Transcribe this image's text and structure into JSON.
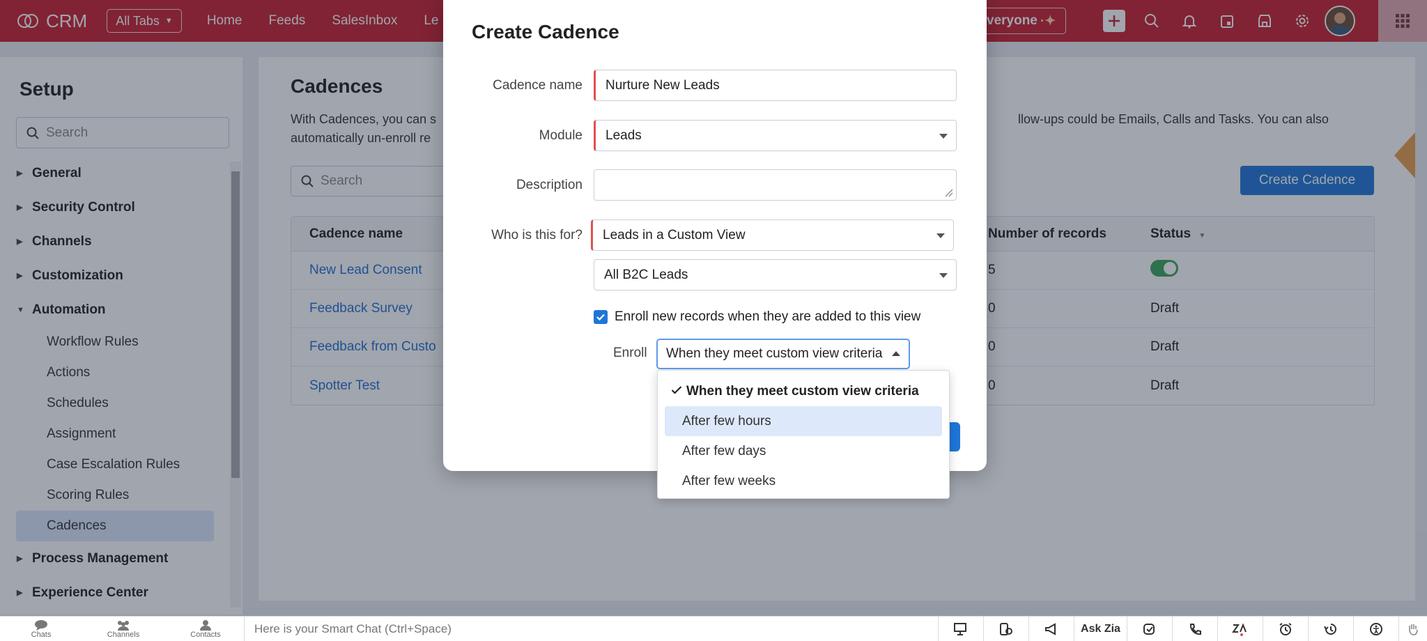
{
  "topbar": {
    "app_name": "CRM",
    "all_tabs_label": "All Tabs",
    "nav": [
      "Home",
      "Feeds",
      "SalesInbox",
      "Le"
    ],
    "everyone_label": "veryone",
    "icons": [
      "plus-icon",
      "search-icon",
      "bell-icon",
      "calendar-icon",
      "store-icon",
      "gear-icon",
      "avatar",
      "grid-icon"
    ]
  },
  "setup": {
    "title": "Setup",
    "search_placeholder": "Search",
    "menu": [
      {
        "label": "General",
        "expanded": false
      },
      {
        "label": "Security Control",
        "expanded": false
      },
      {
        "label": "Channels",
        "expanded": false
      },
      {
        "label": "Customization",
        "expanded": false
      },
      {
        "label": "Automation",
        "expanded": true
      }
    ],
    "automation_items": [
      "Workflow Rules",
      "Actions",
      "Schedules",
      "Assignment",
      "Case Escalation Rules",
      "Scoring Rules",
      "Cadences"
    ],
    "active_item": "Cadences",
    "menu_after": [
      "Process Management",
      "Experience Center"
    ]
  },
  "main": {
    "title": "Cadences",
    "desc_left_1": "With Cadences, you can s",
    "desc_right_1": "llow-ups could be Emails, Calls and Tasks. You can also",
    "desc_left_2": "automatically un-enroll re",
    "search_placeholder": "Search",
    "create_button": "Create Cadence",
    "table": {
      "headers": {
        "name": "Cadence name",
        "records": "Number of records",
        "status": "Status"
      },
      "rows": [
        {
          "name": "New Lead Consent",
          "records": "5",
          "status": "",
          "toggle": true
        },
        {
          "name": "Feedback Survey",
          "records": "0",
          "status": "Draft",
          "toggle": false
        },
        {
          "name": "Feedback from Custo",
          "records": "0",
          "status": "Draft",
          "toggle": false
        },
        {
          "name": "Spotter Test",
          "records": "0",
          "status": "Draft",
          "toggle": false
        }
      ]
    }
  },
  "modal": {
    "title": "Create Cadence",
    "fields": {
      "cadence_name_label": "Cadence name",
      "cadence_name_value": "Nurture New Leads",
      "module_label": "Module",
      "module_value": "Leads",
      "description_label": "Description",
      "description_value": "",
      "who_label": "Who is this for?",
      "who_value": "Leads in a Custom View",
      "view_value": "All B2C Leads"
    },
    "enroll_checkbox_label": "Enroll new records when they are added to this view",
    "enroll_checked": true,
    "enroll_label": "Enroll",
    "enroll_value": "When they meet custom view criteria",
    "dropdown_options": [
      "When they meet custom view criteria",
      "After few hours",
      "After few days",
      "After few weeks"
    ],
    "dropdown_selected": "When they meet custom view criteria",
    "dropdown_hovered": "After few hours"
  },
  "bottombar": {
    "buttons": [
      "Chats",
      "Channels",
      "Contacts"
    ],
    "smart_chat_placeholder": "Here is your Smart Chat (Ctrl+Space)",
    "ask_zia": "Ask Zia"
  },
  "colors": {
    "topbar": "#c8202f",
    "accent_blue": "#1f76d8",
    "link_blue": "#1f6fd1",
    "required_marker": "#e05050",
    "toggle_on": "#3aa65a"
  }
}
